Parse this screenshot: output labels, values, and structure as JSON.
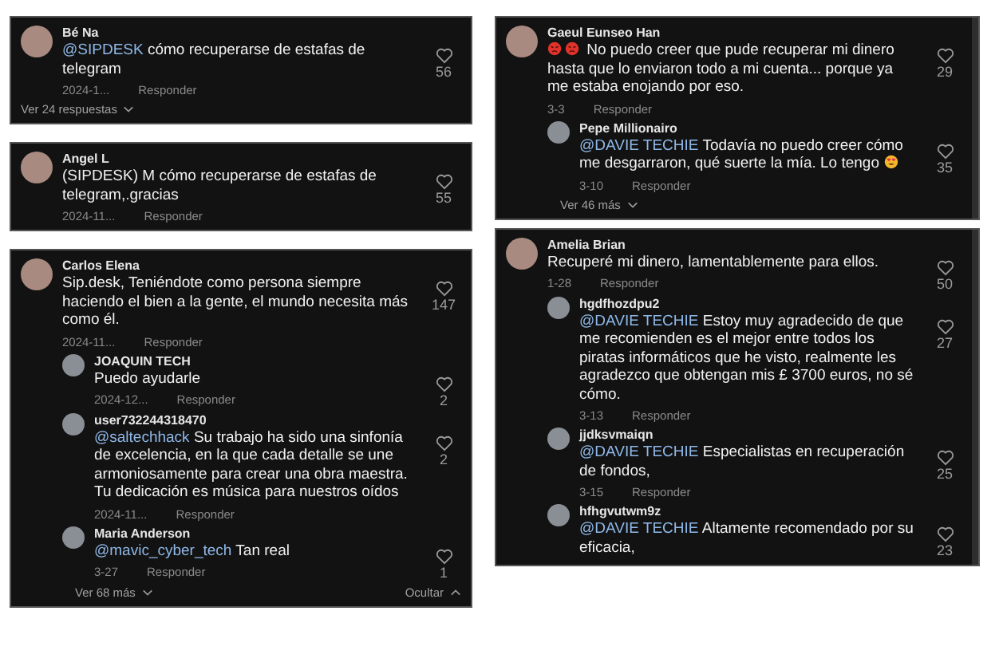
{
  "columns": [
    [
      {
        "comments": [
          {
            "author": "Bé Na",
            "mention": "@SIPDESK",
            "text": "cómo recuperarse de estafas de telegram",
            "date": "2024-1...",
            "reply": "Responder",
            "likes": "56"
          }
        ],
        "more": "Ver 24 respuestas"
      },
      {
        "comments": [
          {
            "author": "Angel L",
            "text": "(SIPDESK) M cómo recuperarse de estafas de telegram,.gracias",
            "date": "2024-11...",
            "reply": "Responder",
            "likes": "55"
          }
        ]
      },
      {
        "comments": [
          {
            "author": "Carlos Elena",
            "text": "Sip.desk, Teniéndote como persona siempre haciendo el bien a la gente, el mundo necesita más como él.",
            "date": "2024-11...",
            "reply": "Responder",
            "likes": "147",
            "replies": [
              {
                "author": "JOAQUIN TECH",
                "text": "Puedo ayudarle",
                "date": "2024-12...",
                "reply": "Responder",
                "likes": "2"
              },
              {
                "author": "user732244318470",
                "mention": "@saltechhack",
                "text": "Su trabajo ha sido una sinfonía de excelencia, en la que cada detalle se une armoniosamente para crear una obra maestra. Tu dedicación es música para nuestros oídos",
                "date": "2024-11...",
                "reply": "Responder",
                "likes": "2"
              },
              {
                "author": "Maria Anderson",
                "mention": "@mavic_cyber_tech",
                "text": "Tan real",
                "date": "3-27",
                "reply": "Responder",
                "likes": "1"
              }
            ]
          }
        ],
        "more": "Ver 68 más",
        "hide": "Ocultar"
      }
    ],
    [
      {
        "comments": [
          {
            "author": "Gaeul Eunseo Han",
            "lead_emojis": [
              {
                "kind": "angry"
              },
              {
                "kind": "angry"
              }
            ],
            "text": "No puedo creer que pude recuperar mi dinero hasta que lo enviaron todo a mi cuenta... porque ya me estaba enojando por eso.",
            "date": "3-3",
            "reply": "Responder",
            "likes": "29",
            "replies": [
              {
                "author": "Pepe Millionairo",
                "mention": "@DAVIE TECHIE",
                "text": "Todavía no puedo creer cómo me desgarraron, qué suerte la mía. Lo tengo",
                "trail_emojis": [
                  {
                    "kind": "heart-eyes"
                  }
                ],
                "date": "3-10",
                "reply": "Responder",
                "likes": "35"
              }
            ]
          }
        ],
        "more": "Ver 46 más",
        "scrollbar": true
      },
      {
        "comments": [
          {
            "author": "Amelia Brian",
            "text": "Recuperé mi dinero, lamentablemente para ellos.",
            "date": "1-28",
            "reply": "Responder",
            "likes": "50",
            "replies": [
              {
                "author": "hgdfhozdpu2",
                "mention": "@DAVIE TECHIE",
                "text": "Estoy muy agradecido de que me recomienden es el mejor entre todos los piratas informáticos que he visto, realmente les agradezco que obtengan mis £ 3700 euros, no sé cómo.",
                "date": "3-13",
                "reply": "Responder",
                "likes": "27"
              },
              {
                "author": "jjdksvmaiqn",
                "mention": "@DAVIE TECHIE",
                "text": "Especialistas en recuperación de fondos,",
                "date": "3-15",
                "reply": "Responder",
                "likes": "25"
              },
              {
                "author": "hfhgvutwm9z",
                "mention": "@DAVIE TECHIE",
                "text": "Altamente recomendado por su eficacia,",
                "likes": "23"
              }
            ]
          }
        ],
        "scrollbar": true
      }
    ]
  ]
}
